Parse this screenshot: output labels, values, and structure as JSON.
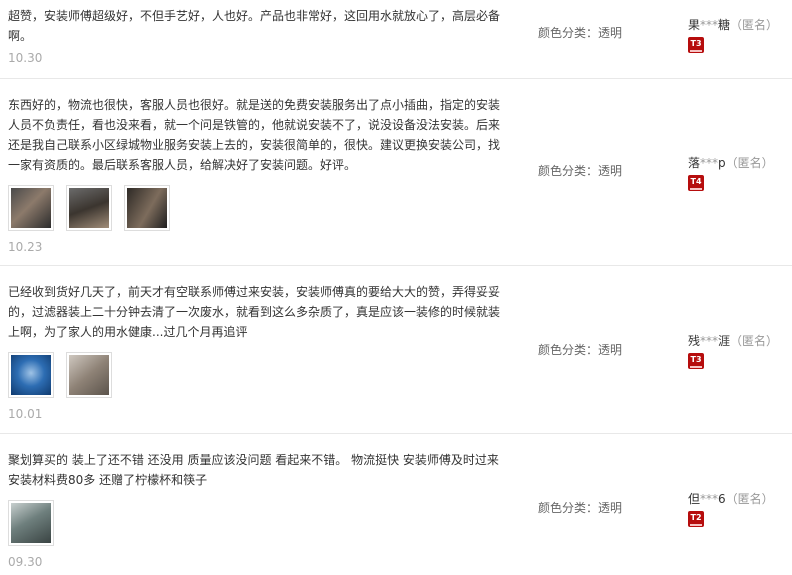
{
  "reviews": [
    {
      "text": "超赞，安装师傅超级好，不但手艺好，人也好。产品也非常好，这回用水就放心了，高层必备啊。",
      "date": "10.30",
      "sku": "颜色分类：透明",
      "user_prefix": "果",
      "user_suffix": "糖",
      "anon": "（匿名）",
      "level": "T3"
    },
    {
      "text": "东西好的，物流也很快，客服人员也很好。就是送的免费安装服务出了点小插曲，指定的安装人员不负责任，看也没来看，就一个问是铁管的，他就说安装不了，说没设备没法安装。后来还是我自己联系小区绿城物业服务安装上去的，安装很简单的，很快。建议更换安装公司，找一家有资质的。最后联系客服人员，给解决好了安装问题。好评。",
      "date": "10.23",
      "sku": "颜色分类：透明",
      "user_prefix": "落",
      "user_suffix": "p",
      "anon": "（匿名）",
      "level": "T4"
    },
    {
      "text": "已经收到货好几天了，前天才有空联系师傅过来安装，安装师傅真的要给大大的赞，弄得妥妥的，过滤器装上二十分钟去清了一次废水，就看到这么多杂质了，真是应该一装修的时候就装上啊，为了家人的用水健康...过几个月再追评",
      "date": "10.01",
      "sku": "颜色分类：透明",
      "user_prefix": "残",
      "user_suffix": "涯",
      "anon": "（匿名）",
      "level": "T3"
    },
    {
      "text": "聚划算买的 装上了还不错 还没用 质量应该没问题 看起来不错。 物流挺快 安装师傅及时过来 安装材料费80多 还赠了柠檬杯和筷子",
      "date": "09.30",
      "sku": "颜色分类：透明",
      "user_prefix": "但",
      "user_suffix": "6",
      "anon": "（匿名）",
      "level": "T2"
    }
  ],
  "masked": "***"
}
